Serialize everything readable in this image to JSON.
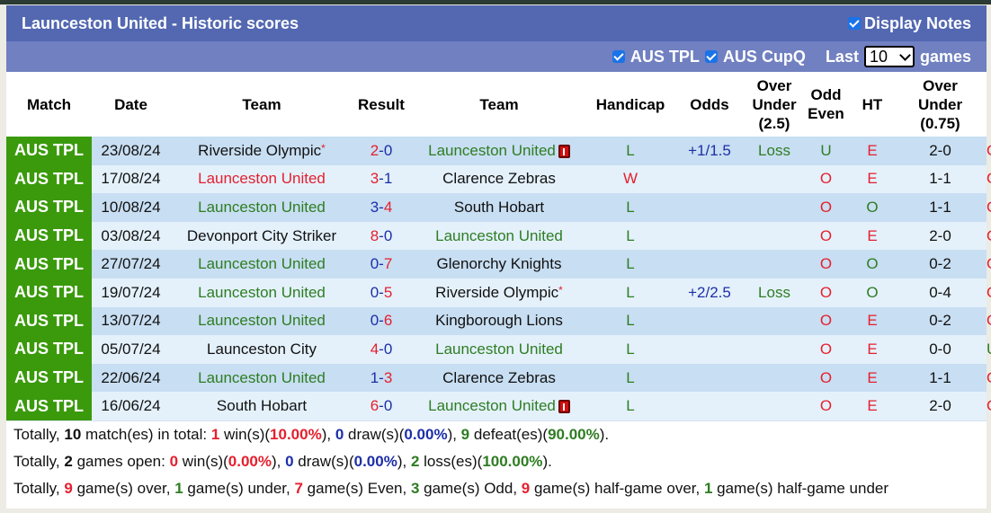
{
  "header": {
    "title": "Launceston United - Historic scores",
    "display_notes_label": "Display Notes",
    "display_notes_checked": true
  },
  "filters": {
    "leagues": [
      {
        "label": "AUS TPL",
        "checked": true
      },
      {
        "label": "AUS CupQ",
        "checked": true
      }
    ],
    "last_label": "Last",
    "games_count": "10",
    "games_label": "games"
  },
  "columns": [
    "Match",
    "Date",
    "Team",
    "Result",
    "Team",
    "Handicap",
    "Odds",
    "Over Under (2.5)",
    "Odd Even",
    "HT",
    "Over Under (0.75)"
  ],
  "colors": {
    "league_bg": "#3a9a0c",
    "title_bg": "#5368b1",
    "filter_bg": "#7080c0",
    "row_odd": "#c8def2",
    "row_even": "#e4f1fb",
    "red": "#e5202e",
    "green": "#2e7d22",
    "blue": "#1d2fa8"
  },
  "rows": [
    {
      "league": "AUS TPL",
      "date": "23/08/24",
      "home": "Riverside Olympic",
      "home_star": "*",
      "home_color": "black",
      "score_home": "2",
      "score_away": "0",
      "score_home_color": "red",
      "score_away_color": "blue",
      "away": "Launceston United",
      "away_color": "green",
      "away_card": true,
      "result": "L",
      "result_color": "green",
      "handicap": "+1/1.5",
      "odds": "Loss",
      "ou": "U",
      "ou_color": "green",
      "oe": "E",
      "oe_color": "red",
      "ht": "2-0",
      "ou2": "O",
      "ou2_color": "red"
    },
    {
      "league": "AUS TPL",
      "date": "17/08/24",
      "home": "Launceston United",
      "home_star": "",
      "home_color": "red",
      "score_home": "3",
      "score_away": "1",
      "score_home_color": "red",
      "score_away_color": "blue",
      "away": "Clarence Zebras",
      "away_color": "black",
      "away_card": false,
      "result": "W",
      "result_color": "red",
      "handicap": "",
      "odds": "",
      "ou": "O",
      "ou_color": "red",
      "oe": "E",
      "oe_color": "red",
      "ht": "1-1",
      "ou2": "O",
      "ou2_color": "red"
    },
    {
      "league": "AUS TPL",
      "date": "10/08/24",
      "home": "Launceston United",
      "home_star": "",
      "home_color": "green",
      "score_home": "3",
      "score_away": "4",
      "score_home_color": "blue",
      "score_away_color": "red",
      "away": "South Hobart",
      "away_color": "black",
      "away_card": false,
      "result": "L",
      "result_color": "green",
      "handicap": "",
      "odds": "",
      "ou": "O",
      "ou_color": "red",
      "oe": "O",
      "oe_color": "green",
      "ht": "1-1",
      "ou2": "O",
      "ou2_color": "red"
    },
    {
      "league": "AUS TPL",
      "date": "03/08/24",
      "home": "Devonport City Striker",
      "home_star": "",
      "home_color": "black",
      "score_home": "8",
      "score_away": "0",
      "score_home_color": "red",
      "score_away_color": "blue",
      "away": "Launceston United",
      "away_color": "green",
      "away_card": false,
      "result": "L",
      "result_color": "green",
      "handicap": "",
      "odds": "",
      "ou": "O",
      "ou_color": "red",
      "oe": "E",
      "oe_color": "red",
      "ht": "2-0",
      "ou2": "O",
      "ou2_color": "red"
    },
    {
      "league": "AUS TPL",
      "date": "27/07/24",
      "home": "Launceston United",
      "home_star": "",
      "home_color": "green",
      "score_home": "0",
      "score_away": "7",
      "score_home_color": "blue",
      "score_away_color": "red",
      "away": "Glenorchy Knights",
      "away_color": "black",
      "away_card": false,
      "result": "L",
      "result_color": "green",
      "handicap": "",
      "odds": "",
      "ou": "O",
      "ou_color": "red",
      "oe": "O",
      "oe_color": "green",
      "ht": "0-2",
      "ou2": "O",
      "ou2_color": "red"
    },
    {
      "league": "AUS TPL",
      "date": "19/07/24",
      "home": "Launceston United",
      "home_star": "",
      "home_color": "green",
      "score_home": "0",
      "score_away": "5",
      "score_home_color": "blue",
      "score_away_color": "red",
      "away": "Riverside Olympic",
      "away_star": "*",
      "away_color": "black",
      "away_card": false,
      "result": "L",
      "result_color": "green",
      "handicap": "+2/2.5",
      "odds": "Loss",
      "ou": "O",
      "ou_color": "red",
      "oe": "O",
      "oe_color": "green",
      "ht": "0-4",
      "ou2": "O",
      "ou2_color": "red"
    },
    {
      "league": "AUS TPL",
      "date": "13/07/24",
      "home": "Launceston United",
      "home_star": "",
      "home_color": "green",
      "score_home": "0",
      "score_away": "6",
      "score_home_color": "blue",
      "score_away_color": "red",
      "away": "Kingborough Lions",
      "away_color": "black",
      "away_card": false,
      "result": "L",
      "result_color": "green",
      "handicap": "",
      "odds": "",
      "ou": "O",
      "ou_color": "red",
      "oe": "E",
      "oe_color": "red",
      "ht": "0-2",
      "ou2": "O",
      "ou2_color": "red"
    },
    {
      "league": "AUS TPL",
      "date": "05/07/24",
      "home": "Launceston City",
      "home_star": "",
      "home_color": "black",
      "score_home": "4",
      "score_away": "0",
      "score_home_color": "red",
      "score_away_color": "blue",
      "away": "Launceston United",
      "away_color": "green",
      "away_card": false,
      "result": "L",
      "result_color": "green",
      "handicap": "",
      "odds": "",
      "ou": "O",
      "ou_color": "red",
      "oe": "E",
      "oe_color": "red",
      "ht": "0-0",
      "ou2": "U",
      "ou2_color": "green"
    },
    {
      "league": "AUS TPL",
      "date": "22/06/24",
      "home": "Launceston United",
      "home_star": "",
      "home_color": "green",
      "score_home": "1",
      "score_away": "3",
      "score_home_color": "blue",
      "score_away_color": "red",
      "away": "Clarence Zebras",
      "away_color": "black",
      "away_card": false,
      "result": "L",
      "result_color": "green",
      "handicap": "",
      "odds": "",
      "ou": "O",
      "ou_color": "red",
      "oe": "E",
      "oe_color": "red",
      "ht": "1-1",
      "ou2": "O",
      "ou2_color": "red"
    },
    {
      "league": "AUS TPL",
      "date": "16/06/24",
      "home": "South Hobart",
      "home_star": "",
      "home_color": "black",
      "score_home": "6",
      "score_away": "0",
      "score_home_color": "red",
      "score_away_color": "blue",
      "away": "Launceston United",
      "away_color": "green",
      "away_card": true,
      "result": "L",
      "result_color": "green",
      "handicap": "",
      "odds": "",
      "ou": "O",
      "ou_color": "red",
      "oe": "E",
      "oe_color": "red",
      "ht": "2-0",
      "ou2": "O",
      "ou2_color": "red"
    }
  ],
  "summary": [
    [
      {
        "t": "Totally, "
      },
      {
        "t": "10",
        "c": "black",
        "b": true
      },
      {
        "t": " match(es) in total: "
      },
      {
        "t": "1",
        "c": "red",
        "b": true
      },
      {
        "t": " win(s)("
      },
      {
        "t": "10.00%",
        "c": "red",
        "b": true
      },
      {
        "t": "), "
      },
      {
        "t": "0",
        "c": "blue",
        "b": true
      },
      {
        "t": " draw(s)("
      },
      {
        "t": "0.00%",
        "c": "blue",
        "b": true
      },
      {
        "t": "), "
      },
      {
        "t": "9",
        "c": "green",
        "b": true
      },
      {
        "t": " defeat(es)("
      },
      {
        "t": "90.00%",
        "c": "green",
        "b": true
      },
      {
        "t": ")."
      }
    ],
    [
      {
        "t": "Totally, "
      },
      {
        "t": "2",
        "c": "black",
        "b": true
      },
      {
        "t": " games open: "
      },
      {
        "t": "0",
        "c": "red",
        "b": true
      },
      {
        "t": " win(s)("
      },
      {
        "t": "0.00%",
        "c": "red",
        "b": true
      },
      {
        "t": "), "
      },
      {
        "t": "0",
        "c": "blue",
        "b": true
      },
      {
        "t": " draw(s)("
      },
      {
        "t": "0.00%",
        "c": "blue",
        "b": true
      },
      {
        "t": "), "
      },
      {
        "t": "2",
        "c": "green",
        "b": true
      },
      {
        "t": " loss(es)("
      },
      {
        "t": "100.00%",
        "c": "green",
        "b": true
      },
      {
        "t": ")."
      }
    ],
    [
      {
        "t": "Totally, "
      },
      {
        "t": "9",
        "c": "red",
        "b": true
      },
      {
        "t": " game(s) over, "
      },
      {
        "t": "1",
        "c": "green",
        "b": true
      },
      {
        "t": " game(s) under, "
      },
      {
        "t": "7",
        "c": "red",
        "b": true
      },
      {
        "t": " game(s) Even, "
      },
      {
        "t": "3",
        "c": "green",
        "b": true
      },
      {
        "t": " game(s) Odd, "
      },
      {
        "t": "9",
        "c": "red",
        "b": true
      },
      {
        "t": " game(s) half-game over, "
      },
      {
        "t": "1",
        "c": "green",
        "b": true
      },
      {
        "t": " game(s) half-game under"
      }
    ]
  ]
}
